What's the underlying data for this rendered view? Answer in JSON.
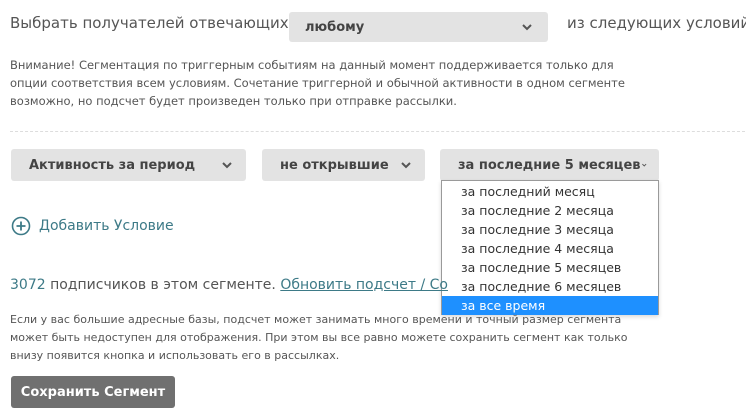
{
  "header": {
    "label": "Выбрать получателей отвечающих",
    "match_value": "любому",
    "suffix": "из следующих условий:"
  },
  "notice": "Внимание! Сегментация по триггерным событиям на данный момент поддерживается только для опции соответствия всем условиям. Сочетание триггерной и обычной активности в одном сегменте возможно, но подсчет будет произведен только при отправке рассылки.",
  "condition": {
    "field_value": "Активность за период",
    "operator_value": "не открывшие",
    "timeframe_value": "за последние 5 месяцев",
    "timeframe_options": [
      "за последний месяц",
      "за последние 2 месяца",
      "за последние 3 месяца",
      "за последние 4 месяца",
      "за последние 5 месяцев",
      "за последние 6 месяцев",
      "за все время"
    ],
    "highlighted_option_index": 6
  },
  "add_condition_label": "Добавить Условие",
  "summary": {
    "count": "3072",
    "text": " подписчиков в этом сегменте. ",
    "refresh_link": "Обновить подсчет / Со"
  },
  "info": "Если у вас большие адресные базы, подсчет может занимать много времени и точный размер сегмента может быть недоступен для отображения. При этом вы все равно можете сохранить сегмент как только внизу появится кнопка и использовать его в рассылках.",
  "save_label": "Сохранить Сегмент",
  "colors": {
    "accent": "#3d7a87",
    "select_bg": "#e3e3e3",
    "highlight": "#1e90ff",
    "button_bg": "#707070"
  },
  "icons": {
    "chevron": "chevron-down-icon",
    "add": "plus-circle-icon"
  }
}
